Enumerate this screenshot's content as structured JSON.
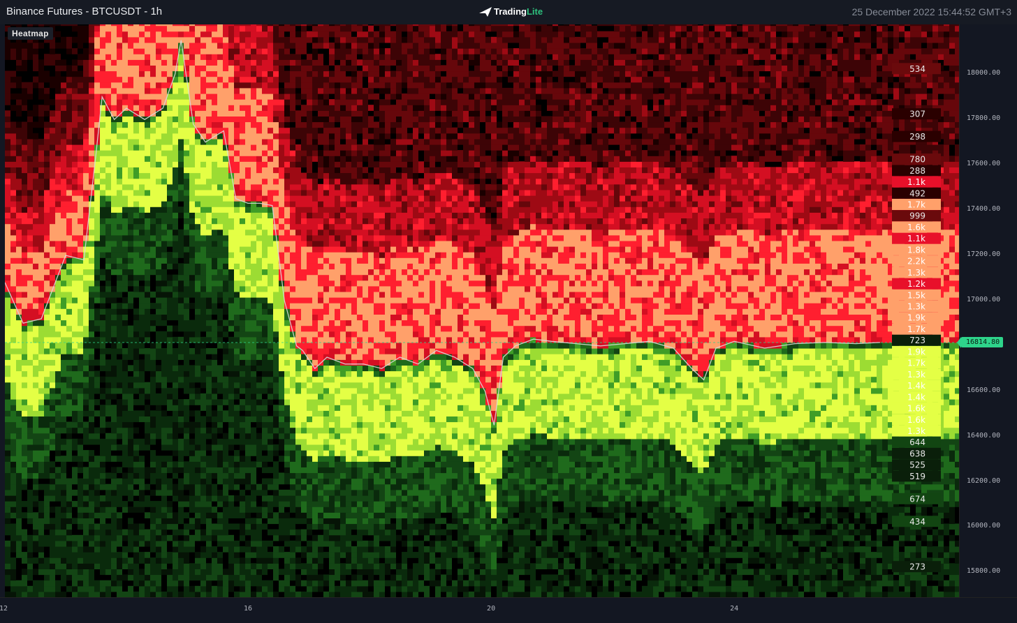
{
  "header": {
    "title": "Binance Futures - BTCUSDT - 1h",
    "logo_text_main": "Trading",
    "logo_text_accent": "Lite",
    "timestamp": "25 December 2022 15:44:52 GMT+3"
  },
  "panel": {
    "label": "Heatmap"
  },
  "colors": {
    "bid_high": "#e4ff45",
    "ask_high": "#ffa06a",
    "ask_mid": "#e8102a",
    "price_line": "#d9d9d9",
    "current_price": "#2ed48b"
  },
  "current_price": {
    "label": "16814.80",
    "value": 16814.8
  },
  "chart_data": {
    "type": "heatmap",
    "ylim": [
      15690,
      18220
    ],
    "y_ticks": [
      {
        "label": "18000.00",
        "value": 18000
      },
      {
        "label": "17800.00",
        "value": 17800
      },
      {
        "label": "17600.00",
        "value": 17600
      },
      {
        "label": "17400.00",
        "value": 17400
      },
      {
        "label": "17200.00",
        "value": 17200
      },
      {
        "label": "17000.00",
        "value": 17000
      },
      {
        "label": "16800.00",
        "value": 16800
      },
      {
        "label": "16600.00",
        "value": 16600
      },
      {
        "label": "16400.00",
        "value": 16400
      },
      {
        "label": "16200.00",
        "value": 16200
      },
      {
        "label": "16000.00",
        "value": 16000
      },
      {
        "label": "15800.00",
        "value": 15800
      }
    ],
    "x_range": [
      12,
      27.7
    ],
    "x_ticks": [
      {
        "label": "12",
        "value": 12
      },
      {
        "label": "16",
        "value": 16
      },
      {
        "label": "20",
        "value": 20
      },
      {
        "label": "24",
        "value": 24
      }
    ],
    "volume_labels": [
      {
        "price": 18025,
        "label": "534",
        "side": "ask",
        "level": 2
      },
      {
        "price": 17825,
        "label": "307",
        "side": "ask",
        "level": 1
      },
      {
        "price": 17725,
        "label": "298",
        "side": "ask",
        "level": 1
      },
      {
        "price": 17625,
        "label": "780",
        "side": "ask",
        "level": 2
      },
      {
        "price": 17575,
        "label": "288",
        "side": "ask",
        "level": 1
      },
      {
        "price": 17525,
        "label": "1.1k",
        "side": "ask",
        "level": 3
      },
      {
        "price": 17475,
        "label": "492",
        "side": "ask",
        "level": 1
      },
      {
        "price": 17425,
        "label": "1.7k",
        "side": "ask",
        "level": 4
      },
      {
        "price": 17375,
        "label": "999",
        "side": "ask",
        "level": 2
      },
      {
        "price": 17325,
        "label": "1.6k",
        "side": "ask",
        "level": 4
      },
      {
        "price": 17275,
        "label": "1.1k",
        "side": "ask",
        "level": 3
      },
      {
        "price": 17225,
        "label": "1.8k",
        "side": "ask",
        "level": 4
      },
      {
        "price": 17175,
        "label": "2.2k",
        "side": "ask",
        "level": 4
      },
      {
        "price": 17125,
        "label": "1.3k",
        "side": "ask",
        "level": 4
      },
      {
        "price": 17075,
        "label": "1.2k",
        "side": "ask",
        "level": 3
      },
      {
        "price": 17025,
        "label": "1.5k",
        "side": "ask",
        "level": 4
      },
      {
        "price": 16975,
        "label": "1.3k",
        "side": "ask",
        "level": 4
      },
      {
        "price": 16925,
        "label": "1.9k",
        "side": "ask",
        "level": 4
      },
      {
        "price": 16875,
        "label": "1.7k",
        "side": "ask",
        "level": 4
      },
      {
        "price": 16825,
        "label": "723",
        "side": "bid",
        "level": 1
      },
      {
        "price": 16775,
        "label": "1.9k",
        "side": "bid",
        "level": 4
      },
      {
        "price": 16725,
        "label": "1.7k",
        "side": "bid",
        "level": 4
      },
      {
        "price": 16675,
        "label": "1.3k",
        "side": "bid",
        "level": 4
      },
      {
        "price": 16625,
        "label": "1.4k",
        "side": "bid",
        "level": 4
      },
      {
        "price": 16575,
        "label": "1.4k",
        "side": "bid",
        "level": 4
      },
      {
        "price": 16525,
        "label": "1.6k",
        "side": "bid",
        "level": 4
      },
      {
        "price": 16475,
        "label": "1.6k",
        "side": "bid",
        "level": 4
      },
      {
        "price": 16425,
        "label": "1.3k",
        "side": "bid",
        "level": 4
      },
      {
        "price": 16375,
        "label": "644",
        "side": "bid",
        "level": 2
      },
      {
        "price": 16325,
        "label": "638",
        "side": "bid",
        "level": 1
      },
      {
        "price": 16275,
        "label": "525",
        "side": "bid",
        "level": 1
      },
      {
        "price": 16225,
        "label": "519",
        "side": "bid",
        "level": 1
      },
      {
        "price": 16125,
        "label": "674",
        "side": "bid",
        "level": 2
      },
      {
        "price": 16025,
        "label": "434",
        "side": "bid",
        "level": 2
      },
      {
        "price": 15825,
        "label": "273",
        "side": "bid",
        "level": 1
      }
    ],
    "price_series": {
      "x": [
        12,
        12.3,
        12.6,
        13,
        13.3,
        13.5,
        13.6,
        13.8,
        14,
        14.3,
        14.6,
        14.8,
        14.9,
        15.1,
        15.3,
        15.6,
        15.8,
        16,
        16.2,
        16.4,
        16.6,
        16.8,
        16.9,
        17.1,
        17.3,
        17.6,
        17.9,
        18.2,
        18.5,
        18.8,
        19.1,
        19.4,
        19.7,
        19.9,
        20.05,
        20.2,
        20.4,
        20.7,
        21,
        21.4,
        21.8,
        22.2,
        22.6,
        23,
        23.3,
        23.5,
        23.7,
        24,
        24.5,
        25,
        25.5,
        26,
        26.4
      ],
      "y": [
        17080,
        16900,
        16920,
        17200,
        17180,
        17650,
        17900,
        17800,
        17850,
        17800,
        17850,
        18000,
        18150,
        17780,
        17700,
        17750,
        17450,
        17430,
        17430,
        17420,
        17000,
        16800,
        16780,
        16700,
        16750,
        16720,
        16720,
        16700,
        16750,
        16720,
        16780,
        16750,
        16700,
        16600,
        16450,
        16750,
        16800,
        16830,
        16820,
        16810,
        16800,
        16810,
        16820,
        16790,
        16700,
        16650,
        16790,
        16820,
        16790,
        16810,
        16815,
        16810,
        16815
      ]
    }
  }
}
